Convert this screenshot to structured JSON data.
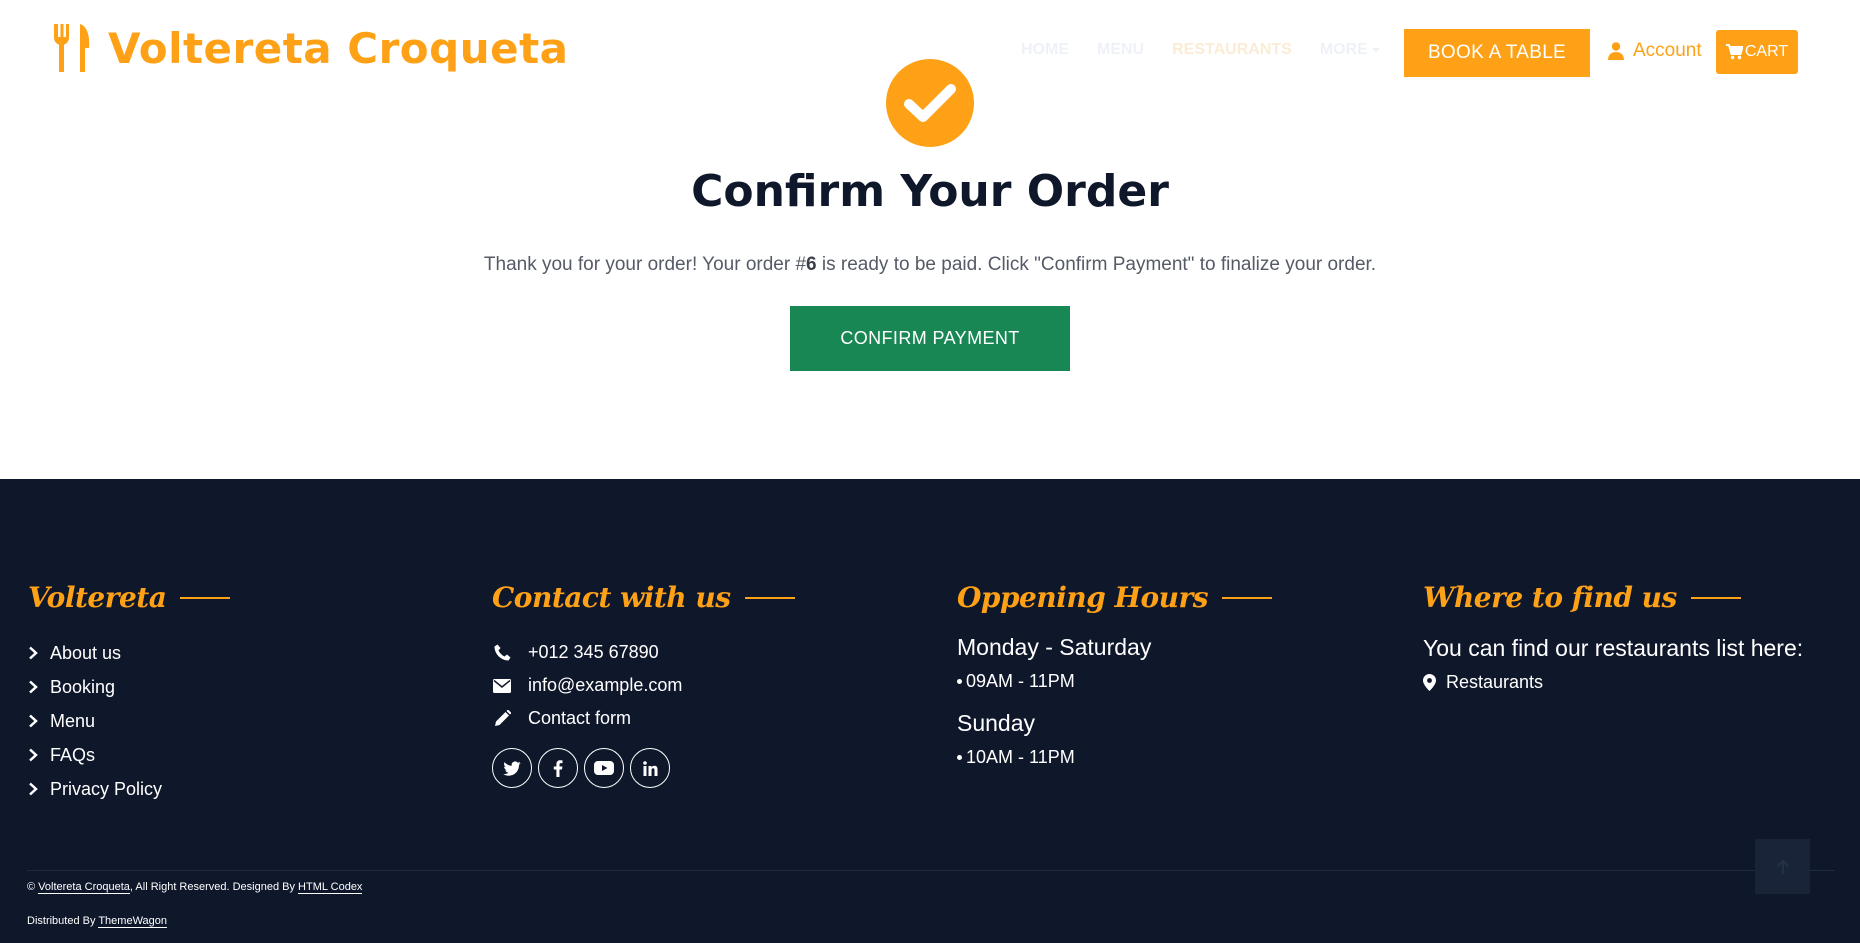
{
  "colors": {
    "accent": "#FEA116",
    "navy": "#0F172B",
    "success": "#198754"
  },
  "brand": {
    "name": "Voltereta Croqueta",
    "icon": "utensils-icon"
  },
  "nav": {
    "links": [
      {
        "label": "HOME"
      },
      {
        "label": "MENU"
      },
      {
        "label": "RESTAURANTS"
      },
      {
        "label": "MORE"
      }
    ],
    "book_label": "BOOK A TABLE",
    "account_label": "Account",
    "cart_label": "CART"
  },
  "main": {
    "title": "Confirm Your Order",
    "message_pre": "Thank you for your order! Your order #",
    "order_number": "6",
    "message_post": " is ready to be paid. Click \"Confirm Payment\" to finalize your order.",
    "confirm_label": "CONFIRM PAYMENT"
  },
  "footer": {
    "col1": {
      "heading": "Voltereta",
      "links": [
        "About us",
        "Booking",
        "Menu",
        "FAQs",
        "Privacy Policy"
      ]
    },
    "col2": {
      "heading": "Contact with us",
      "phone": "+012 345 67890",
      "email": "info@example.com",
      "form": "Contact form",
      "socials": [
        "twitter-icon",
        "facebook-icon",
        "youtube-icon",
        "linkedin-icon"
      ]
    },
    "col3": {
      "heading": "Oppening Hours",
      "day1": "Monday - Saturday",
      "hours1": "09AM - 11PM",
      "day2": "Sunday",
      "hours2": "10AM - 11PM"
    },
    "col4": {
      "heading": "Where to find us",
      "text": "You can find our restaurants list here:",
      "link": "Restaurants"
    },
    "copyright": {
      "symbol": "©",
      "site": "Voltereta Croqueta",
      "rights": ", All Right Reserved. Designed By ",
      "designer": "HTML Codex",
      "distributed": "Distributed By ",
      "distributor": "ThemeWagon"
    }
  }
}
